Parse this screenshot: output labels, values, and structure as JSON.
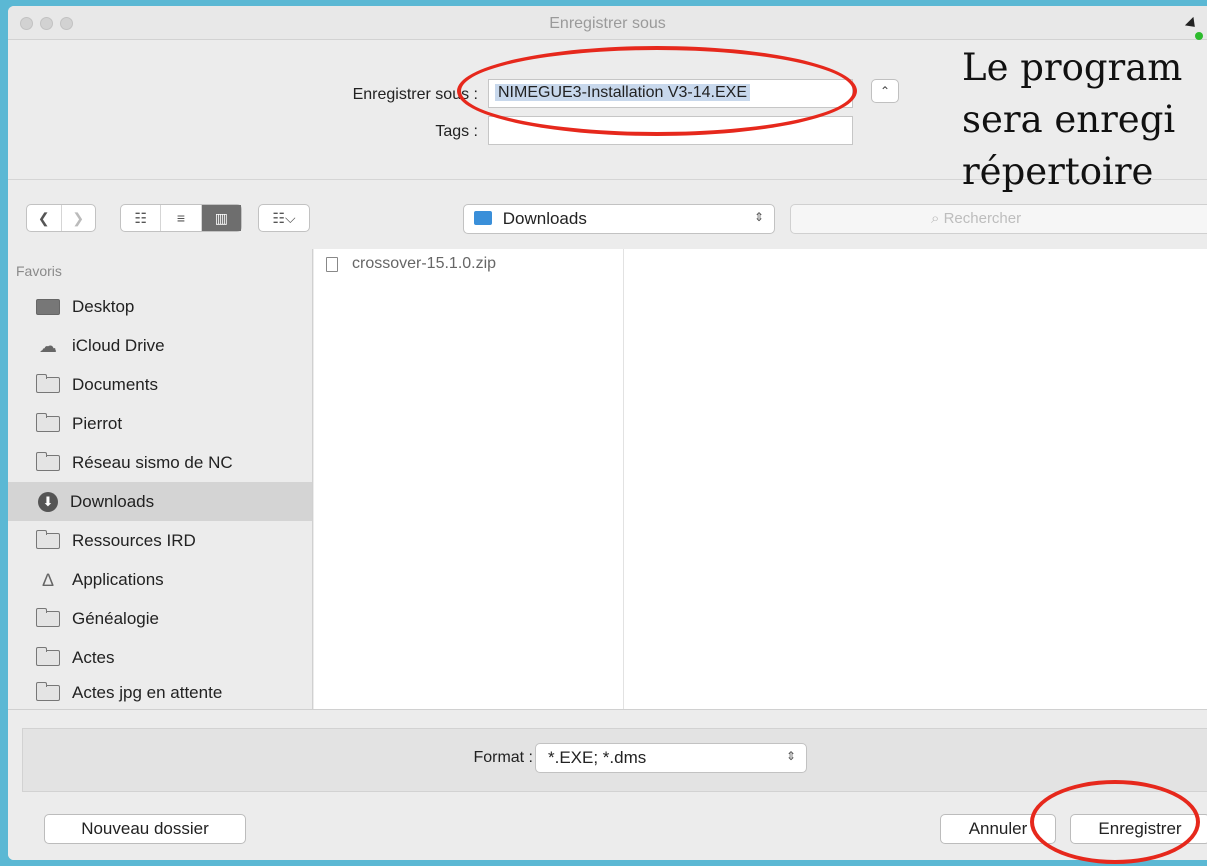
{
  "window": {
    "title": "Enregistrer sous"
  },
  "header": {
    "save_as_label": "Enregistrer sous :",
    "save_as_value": "NIMEGUE3-Installation V3-14.EXE",
    "tags_label": "Tags :",
    "tags_value": ""
  },
  "toolbar": {
    "location": "Downloads",
    "search_placeholder": "Rechercher"
  },
  "sidebar": {
    "heading": "Favoris",
    "items": [
      {
        "label": "Desktop",
        "icon": "desktop-icon"
      },
      {
        "label": "iCloud Drive",
        "icon": "cloud-icon"
      },
      {
        "label": "Documents",
        "icon": "folder-icon"
      },
      {
        "label": "Pierrot",
        "icon": "folder-icon"
      },
      {
        "label": "Réseau sismo de NC",
        "icon": "folder-icon"
      },
      {
        "label": "Downloads",
        "icon": "downloads-icon",
        "selected": true
      },
      {
        "label": "Ressources IRD",
        "icon": "folder-icon"
      },
      {
        "label": "Applications",
        "icon": "applications-icon"
      },
      {
        "label": "Généalogie",
        "icon": "folder-icon"
      },
      {
        "label": "Actes",
        "icon": "folder-icon"
      },
      {
        "label": "Actes jpg en attente",
        "icon": "folder-icon"
      }
    ]
  },
  "files": [
    {
      "name": "crossover-15.1.0.zip",
      "icon": "file-icon"
    }
  ],
  "footer": {
    "format_label": "Format :",
    "format_value": "*.EXE; *.dms",
    "new_folder": "Nouveau dossier",
    "cancel": "Annuler",
    "save": "Enregistrer"
  },
  "annotation": {
    "text": "Le program\nsera enregi\nrépertoire",
    "highlight_color": "#e6281c"
  }
}
